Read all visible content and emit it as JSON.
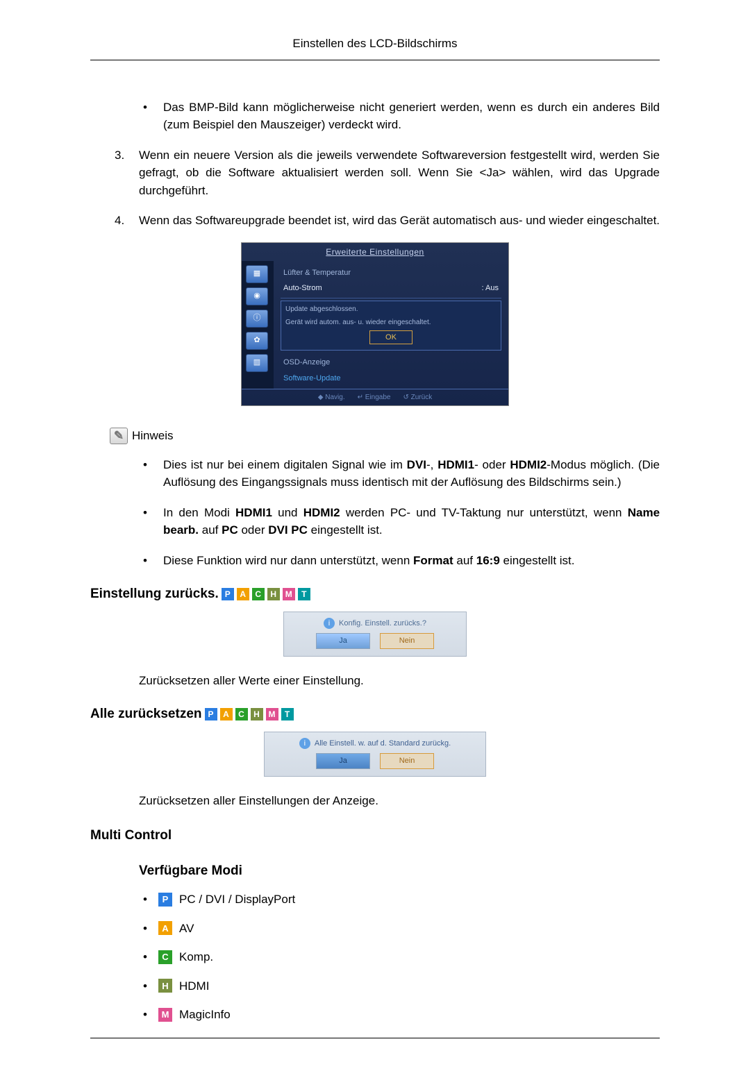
{
  "header": {
    "title": "Einstellen des LCD-Bildschirms"
  },
  "top": {
    "bullet1": "Das BMP-Bild kann möglicherweise nicht generiert werden, wenn es durch ein anderes Bild (zum Beispiel den Mauszeiger) verdeckt wird.",
    "num3": "3.",
    "text3_a": "Wenn ein neuere Version als die jeweils verwendete Softwareversion festgestellt wird, werden Sie gefragt, ob die Software aktualisiert werden soll. Wenn Sie ",
    "text3_ja": "<Ja>",
    "text3_b": " wählen, wird das Upgrade durchgeführt.",
    "num4": "4.",
    "text4": "Wenn das Softwareupgrade beendet ist, wird das Gerät automatisch aus- und wieder eingeschaltet."
  },
  "osd": {
    "title": "Erweiterte Einstellungen",
    "row1": "Lüfter & Temperatur",
    "row2_l": "Auto-Strom",
    "row2_r": ": Aus",
    "popup1": "Update abgeschlossen.",
    "popup2": "Gerät wird autom. aus- u. wieder eingeschaltet.",
    "ok": "OK",
    "row3": "OSD-Anzeige",
    "row4": "Software-Update",
    "foot_nav": "◆ Navig.",
    "foot_enter": "↵ Eingabe",
    "foot_back": "↺ Zurück"
  },
  "note": {
    "label": "Hinweis",
    "b1_a": "Dies ist nur bei einem digitalen Signal wie im ",
    "b1_dvi": "DVI",
    "b1_sep1": "-, ",
    "b1_hdmi1": "HDMI1",
    "b1_sep2": "- oder ",
    "b1_hdmi2": "HDMI2",
    "b1_b": "-Modus möglich. (Die Auflösung des Eingangssignals muss identisch mit der Auflösung des Bildschirms sein.)",
    "b2_a": "In den Modi ",
    "b2_hdmi1": "HDMI1",
    "b2_and": " und ",
    "b2_hdmi2": "HDMI2",
    "b2_b": " werden PC- und TV-Taktung nur unterstützt, wenn ",
    "b2_name": "Name bearb.",
    "b2_c": " auf ",
    "b2_pc": "PC",
    "b2_d": " oder ",
    "b2_dvipc": "DVI PC",
    "b2_e": " eingestellt ist.",
    "b3_a": "Diese Funktion wird nur dann unterstützt, wenn ",
    "b3_format": "Format",
    "b3_b": " auf ",
    "b3_169": "16:9",
    "b3_c": " eingestellt ist."
  },
  "sec1": {
    "heading": "Einstellung zurücks.",
    "dlg_msg": "Konfig. Einstell. zurücks.?",
    "ja": "Ja",
    "nein": "Nein",
    "para": "Zurücksetzen aller Werte einer Einstellung."
  },
  "sec2": {
    "heading": "Alle zurücksetzen",
    "dlg_msg": "Alle Einstell. w. auf d. Standard zurückg.",
    "ja": "Ja",
    "nein": "Nein",
    "para": "Zurücksetzen aller Einstellungen der Anzeige."
  },
  "multi": {
    "heading": "Multi Control",
    "sub": "Verfügbare Modi",
    "m1": "PC / DVI / DisplayPort",
    "m2": "AV",
    "m3": "Komp.",
    "m4": "HDMI",
    "m5": "MagicInfo"
  },
  "tags": {
    "p": "P",
    "a": "A",
    "c": "C",
    "h": "H",
    "m": "M",
    "t": "T"
  }
}
